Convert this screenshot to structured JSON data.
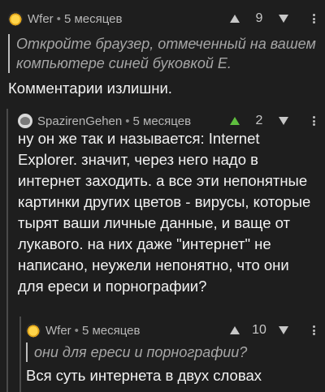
{
  "comments": [
    {
      "username": "Wfer",
      "separator": "•",
      "time": "5 месяцев",
      "score": "9",
      "quote": "Откройте браузер, отмеченный на вашем\nкомпьютере синей буковкой Е.",
      "text": "Комментарии излишни."
    },
    {
      "username": "SpazirenGehen",
      "separator": "•",
      "time": "5 месяцев",
      "score": "2",
      "text": "ну он же так и называется: Internet\nExplorer. значит, через него надо в\nинтернет заходить. а все эти непонятные\nкартинки других цветов - вирусы, которые\nтырят ваши личные данные, и ваще от\nлукавого. на них даже \"интернет\" не\nнаписано, неужели непонятно, что они\nдля ереси и порнографии?"
    },
    {
      "username": "Wfer",
      "separator": "•",
      "time": "5 месяцев",
      "score": "10",
      "quote": "они для ереси и порнографии?",
      "text": "Вся суть интернета в двух словах"
    }
  ],
  "colors": {
    "background": "#1e1e1e",
    "upvote_active": "#5fbf3f"
  },
  "icons": {
    "upvote": "arrow-up",
    "downvote": "arrow-down",
    "more": "kebab-vertical"
  }
}
